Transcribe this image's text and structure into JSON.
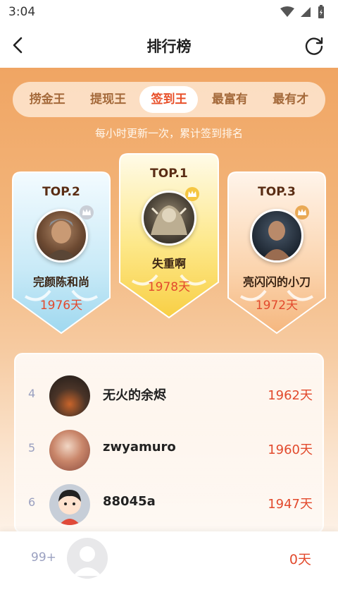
{
  "status": {
    "time": "3:04"
  },
  "header": {
    "title": "排行榜"
  },
  "tabs": [
    {
      "label": "捞金王",
      "active": false
    },
    {
      "label": "提现王",
      "active": false
    },
    {
      "label": "签到王",
      "active": true
    },
    {
      "label": "最富有",
      "active": false
    },
    {
      "label": "最有才",
      "active": false
    }
  ],
  "subtitle": "每小时更新一次，累计签到排名",
  "podium": {
    "first": {
      "rank_label": "TOP.1",
      "name": "失重啊",
      "days": "1978天"
    },
    "second": {
      "rank_label": "TOP.2",
      "name": "完颜陈和尚",
      "days": "1976天"
    },
    "third": {
      "rank_label": "TOP.3",
      "name": "亮闪闪的小刀",
      "days": "1972天"
    }
  },
  "list": [
    {
      "rank": "4",
      "name": "无火的余烬",
      "days": "1962天"
    },
    {
      "rank": "5",
      "name": "zwyamuro",
      "days": "1960天"
    },
    {
      "rank": "6",
      "name": "88045a",
      "days": "1947天"
    }
  ],
  "me": {
    "rank": "99+",
    "days": "0天"
  },
  "colors": {
    "accent": "#e8502a",
    "days_red": "#e24a2d",
    "header_bg": "#f0a563"
  }
}
